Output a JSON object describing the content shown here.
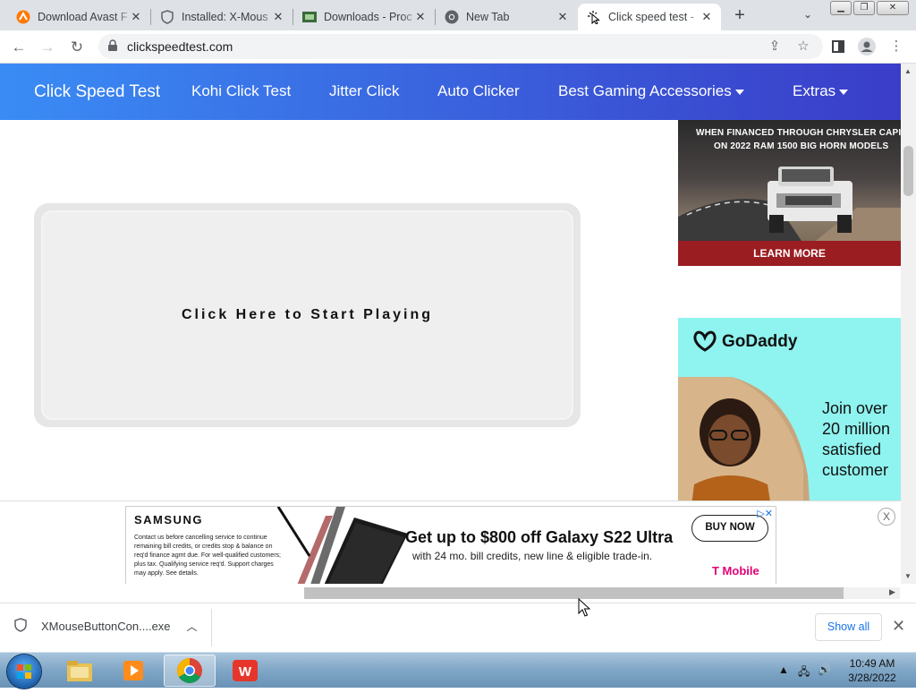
{
  "browser": {
    "tabs": [
      {
        "title": "Download Avast F",
        "icon": "avast-icon"
      },
      {
        "title": "Installed: X-Mous",
        "icon": "shield-icon"
      },
      {
        "title": "Downloads - Proc",
        "icon": "downloads-site-icon"
      },
      {
        "title": "New Tab",
        "icon": "chrome-icon"
      },
      {
        "title": "Click speed test -",
        "icon": "cursor-click-icon",
        "active": true
      }
    ],
    "url": "clickspeedtest.com"
  },
  "site_nav": {
    "brand": "Click Speed Test",
    "links": [
      "Kohi Click Test",
      "Jitter Click",
      "Auto Clicker",
      "Best Gaming Accessories",
      "Extras"
    ]
  },
  "main": {
    "play_label": "Click Here to Start Playing"
  },
  "ads": {
    "ram": {
      "line1": "WHEN FINANCED THROUGH CHRYSLER CAPIT",
      "line2": "ON 2022 RAM 1500 BIG HORN MODELS",
      "cta": "LEARN MORE"
    },
    "godaddy": {
      "logo": "GoDaddy",
      "lines": [
        "Join over",
        "20 million",
        "satisfied",
        "customer"
      ]
    },
    "samsung": {
      "brand": "SAMSUNG",
      "fine_print": "Contact us before cancelling service to continue remaining bill credits, or credits stop & balance on req'd finance agmt due. For well-qualified customers; plus tax. Qualifying service req'd. Support charges may apply. See details.",
      "headline": "Get up to $800 off Galaxy S22 Ultra",
      "subline": "with 24 mo. bill credits, new line & eligible trade-in.",
      "button": "BUY NOW",
      "carrier": "T Mobile",
      "close": "X"
    }
  },
  "download_bar": {
    "file": "XMouseButtonCon....exe",
    "show_all": "Show all"
  },
  "taskbar": {
    "time": "10:49 AM",
    "date": "3/28/2022"
  }
}
